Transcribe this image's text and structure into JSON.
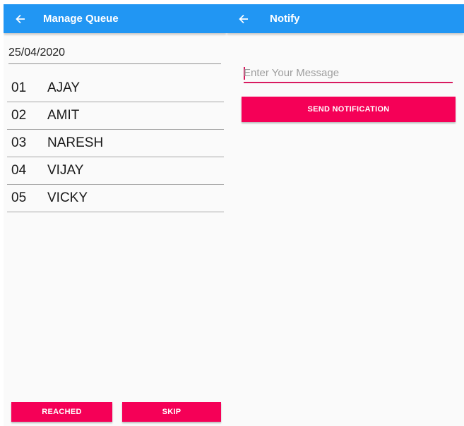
{
  "manage_queue": {
    "title": "Manage Queue",
    "date": "25/04/2020",
    "queue": [
      {
        "number": "01",
        "name": "AJAY"
      },
      {
        "number": "02",
        "name": "AMIT"
      },
      {
        "number": "03",
        "name": "NARESH"
      },
      {
        "number": "04",
        "name": "VIJAY"
      },
      {
        "number": "05",
        "name": "VICKY"
      }
    ],
    "reached_label": "REACHED",
    "skip_label": "SKIP"
  },
  "notify": {
    "title": "Notify",
    "message_placeholder": "Enter Your Message",
    "message_value": "",
    "send_label": "SEND NOTIFICATION"
  },
  "colors": {
    "appbar": "#2196f3",
    "accent": "#f50057",
    "background": "#fafafa"
  },
  "icons": {
    "back": "arrow-left-icon"
  }
}
